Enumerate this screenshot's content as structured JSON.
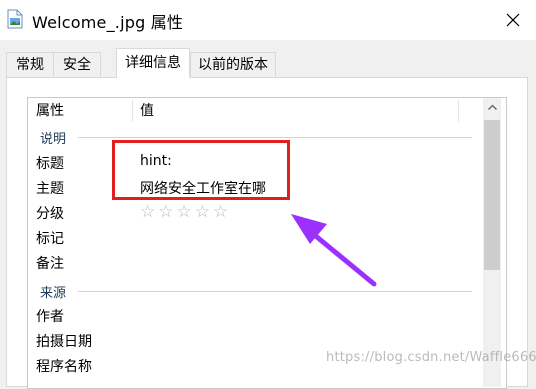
{
  "window": {
    "title": "Welcome_.jpg 属性"
  },
  "tabs": [
    {
      "label": "常规",
      "active": false
    },
    {
      "label": "安全",
      "active": false
    },
    {
      "label": "详细信息",
      "active": true
    },
    {
      "label": "以前的版本",
      "active": false
    }
  ],
  "details": {
    "headers": {
      "property": "属性",
      "value": "值"
    },
    "groups": [
      {
        "name": "说明",
        "rows": [
          {
            "label": "标题",
            "value": "hint:"
          },
          {
            "label": "主题",
            "value": "网络安全工作室在哪"
          },
          {
            "label": "分级",
            "value": "",
            "rating_stars": 0,
            "rating_max": 5
          },
          {
            "label": "标记",
            "value": ""
          },
          {
            "label": "备注",
            "value": ""
          }
        ]
      },
      {
        "name": "来源",
        "rows": [
          {
            "label": "作者",
            "value": ""
          },
          {
            "label": "拍摄日期",
            "value": ""
          },
          {
            "label": "程序名称",
            "value": ""
          }
        ]
      }
    ]
  },
  "annotations": {
    "highlight_color": "#e0201e",
    "arrow_color": "#9b30ff"
  },
  "watermark": "https://blog.csdn.net/Waffle666",
  "icons": {
    "star": "☆",
    "close": "close-icon",
    "scroll_up": "chevron-up-icon"
  }
}
